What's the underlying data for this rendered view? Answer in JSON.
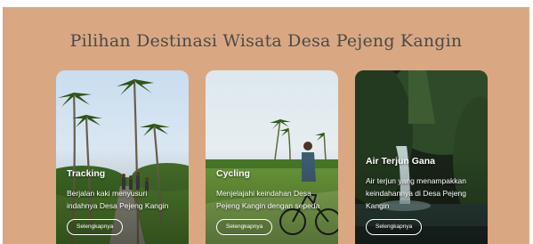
{
  "section": {
    "heading": "Pilihan Destinasi Wisata Desa Pejeng Kangin",
    "background_color": "#d9a882"
  },
  "cards": [
    {
      "title": "Tracking",
      "description": "Berjalan kaki menyusuri indahnya Desa Pejeng Kangin",
      "button_label": "Selengkapnya",
      "image": "palm-trees-tracking-photo"
    },
    {
      "title": "Cycling",
      "description": "Menjelajahi keindahan Desa Pejeng Kangin dengan sepeda",
      "button_label": "Selengkapnya",
      "image": "cyclist-rice-field-photo"
    },
    {
      "title": "Air Terjun Gana",
      "description": "Air terjun yang menampakkan keindahannya di Desa Pejeng Kangin",
      "button_label": "Selengkapnya",
      "image": "waterfall-jungle-photo"
    }
  ]
}
